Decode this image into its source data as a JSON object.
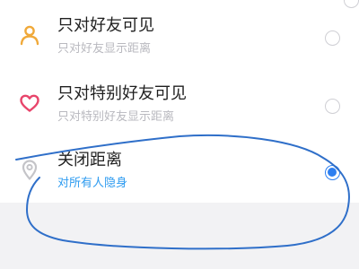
{
  "options": [
    {
      "title": "只对好友可见",
      "subtitle": "只对好友显示距离",
      "icon": "person-icon",
      "icon_color": "#f0a93a",
      "selected": false
    },
    {
      "title": "只对特别好友可见",
      "subtitle": "只对特别好友显示距离",
      "icon": "heart-icon",
      "icon_color": "#e8456b",
      "selected": false
    },
    {
      "title": "关闭距离",
      "subtitle": "对所有人隐身",
      "icon": "location-pin-icon",
      "icon_color": "#c4c4c8",
      "selected": true
    }
  ],
  "colors": {
    "accent": "#2d9bf0",
    "annotation_stroke": "#2f6fc9"
  }
}
